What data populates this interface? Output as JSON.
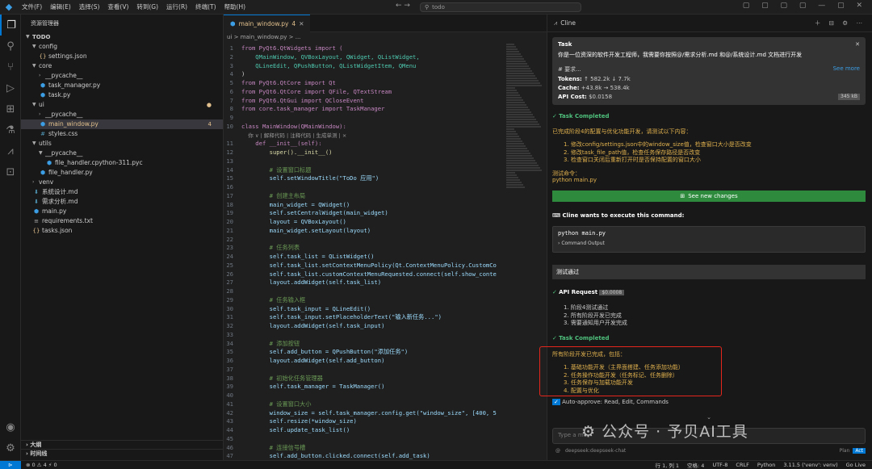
{
  "titlebar": {
    "menus": [
      "文件(F)",
      "编辑(E)",
      "选择(S)",
      "查看(V)",
      "转到(G)",
      "运行(R)",
      "终端(T)",
      "帮助(H)"
    ],
    "search": "todo"
  },
  "sidebar": {
    "title": "资源管理器",
    "root": "TODO",
    "items": [
      {
        "label": "config",
        "depth": 1,
        "type": "folder",
        "open": true
      },
      {
        "label": "settings.json",
        "depth": 2,
        "type": "json"
      },
      {
        "label": "core",
        "depth": 1,
        "type": "folder",
        "open": true
      },
      {
        "label": "__pycache__",
        "depth": 2,
        "type": "folder",
        "open": false
      },
      {
        "label": "task_manager.py",
        "depth": 2,
        "type": "py"
      },
      {
        "label": "task.py",
        "depth": 2,
        "type": "py"
      },
      {
        "label": "ui",
        "depth": 1,
        "type": "folder",
        "open": true,
        "mod": true
      },
      {
        "label": "__pycache__",
        "depth": 2,
        "type": "folder",
        "open": false
      },
      {
        "label": "main_window.py",
        "depth": 2,
        "type": "py",
        "sel": true,
        "badge": "4"
      },
      {
        "label": "styles.css",
        "depth": 2,
        "type": "css"
      },
      {
        "label": "utils",
        "depth": 1,
        "type": "folder",
        "open": true
      },
      {
        "label": "__pycache__",
        "depth": 2,
        "type": "folder",
        "open": true
      },
      {
        "label": "file_handler.cpython-311.pyc",
        "depth": 3,
        "type": "pyc"
      },
      {
        "label": "file_handler.py",
        "depth": 2,
        "type": "py"
      },
      {
        "label": "venv",
        "depth": 1,
        "type": "folder",
        "open": false
      },
      {
        "label": "系统设计.md",
        "depth": 1,
        "type": "md"
      },
      {
        "label": "需求分析.md",
        "depth": 1,
        "type": "md"
      },
      {
        "label": "main.py",
        "depth": 1,
        "type": "py"
      },
      {
        "label": "requirements.txt",
        "depth": 1,
        "type": "txt"
      },
      {
        "label": "tasks.json",
        "depth": 1,
        "type": "json"
      }
    ],
    "outline": "大纲",
    "timeline": "时间线"
  },
  "editor": {
    "tab": "main_window.py",
    "tab_badge": "4",
    "breadcrumb": "ui  >  main_window.py  > ...",
    "lines": [
      {
        "n": "1",
        "t": "from PyQt6.QtWidgets import ("
      },
      {
        "n": "2",
        "t": "    QMainWindow, QVBoxLayout, QWidget, QListWidget,"
      },
      {
        "n": "3",
        "t": "    QLineEdit, QPushButton, QListWidgetItem, QMenu"
      },
      {
        "n": "4",
        "t": ")"
      },
      {
        "n": "5",
        "t": "from PyQt6.QtCore import Qt"
      },
      {
        "n": "6",
        "t": "from PyQt6.QtCore import QFile, QTextStream"
      },
      {
        "n": "7",
        "t": "from PyQt6.QtGui import QCloseEvent"
      },
      {
        "n": "8",
        "t": "from core.task_manager import TaskManager"
      },
      {
        "n": "9",
        "t": ""
      },
      {
        "n": "10",
        "t": "class MainWindow(QMainWindow):"
      },
      {
        "n": "",
        "t": "    你 ∨ | 解释代码 | 注释代码 | 生成单测 | ×",
        "hint": true
      },
      {
        "n": "11",
        "t": "    def __init__(self):"
      },
      {
        "n": "12",
        "t": "        super().__init__()"
      },
      {
        "n": "13",
        "t": ""
      },
      {
        "n": "14",
        "t": "        # 设置窗口标题"
      },
      {
        "n": "15",
        "t": "        self.setWindowTitle(\"ToDo 应用\")"
      },
      {
        "n": "16",
        "t": ""
      },
      {
        "n": "17",
        "t": "        # 创建主布局"
      },
      {
        "n": "18",
        "t": "        main_widget = QWidget()"
      },
      {
        "n": "19",
        "t": "        self.setCentralWidget(main_widget)"
      },
      {
        "n": "20",
        "t": "        layout = QVBoxLayout()"
      },
      {
        "n": "21",
        "t": "        main_widget.setLayout(layout)"
      },
      {
        "n": "22",
        "t": ""
      },
      {
        "n": "23",
        "t": "        # 任务列表"
      },
      {
        "n": "24",
        "t": "        self.task_list = QListWidget()"
      },
      {
        "n": "25",
        "t": "        self.task_list.setContextMenuPolicy(Qt.ContextMenuPolicy.CustomCo"
      },
      {
        "n": "26",
        "t": "        self.task_list.customContextMenuRequested.connect(self.show_conte"
      },
      {
        "n": "27",
        "t": "        layout.addWidget(self.task_list)"
      },
      {
        "n": "28",
        "t": ""
      },
      {
        "n": "29",
        "t": "        # 任务输入框"
      },
      {
        "n": "30",
        "t": "        self.task_input = QLineEdit()"
      },
      {
        "n": "31",
        "t": "        self.task_input.setPlaceholderText(\"输入新任务...\")"
      },
      {
        "n": "32",
        "t": "        layout.addWidget(self.task_input)"
      },
      {
        "n": "33",
        "t": ""
      },
      {
        "n": "34",
        "t": "        # 添加按钮"
      },
      {
        "n": "35",
        "t": "        self.add_button = QPushButton(\"添加任务\")"
      },
      {
        "n": "36",
        "t": "        layout.addWidget(self.add_button)"
      },
      {
        "n": "37",
        "t": ""
      },
      {
        "n": "38",
        "t": "        # 初始化任务管理器"
      },
      {
        "n": "39",
        "t": "        self.task_manager = TaskManager()"
      },
      {
        "n": "40",
        "t": ""
      },
      {
        "n": "41",
        "t": "        # 设置窗口大小"
      },
      {
        "n": "42",
        "t": "        window_size = self.task_manager.config.get(\"window_size\", [400, 5"
      },
      {
        "n": "43",
        "t": "        self.resize(*window_size)"
      },
      {
        "n": "44",
        "t": "        self.update_task_list()"
      },
      {
        "n": "45",
        "t": ""
      },
      {
        "n": "46",
        "t": "        # 连接信号槽"
      },
      {
        "n": "47",
        "t": "        self.add_button.clicked.connect(self.add_task)"
      }
    ]
  },
  "cline": {
    "title": "Cline",
    "task": {
      "label": "Task",
      "text": "你是一位资深的软件开发工程师，我需要你按照@/需求分析.md 和@/系统设计.md 文档进行开发",
      "req": "# 要求...",
      "see_more": "See more",
      "tokens_label": "Tokens:",
      "tokens": "↑ 582.2k ↓ 7.7k",
      "cache_label": "Cache:",
      "cache": "+43.8k → 538.4k",
      "cost_label": "API Cost:",
      "cost": "$0.0158",
      "size": "345 kB"
    },
    "completed1": "Task Completed",
    "summary_title": "已完成阶段4的配置与优化功能开发，请测试以下内容：",
    "summary_items": [
      "1. 修改config/settings.json中的window_size值，检查窗口大小是否改变",
      "2. 修改task_file_path值，检查任务保存路径是否改变",
      "3. 检查窗口关闭后重新打开时是否保持配置的窗口大小"
    ],
    "test_cmd_label": "测试命令：",
    "test_cmd": "python main.py",
    "see_changes": "See new changes",
    "execute_label": "Cline wants to execute this command:",
    "command": "python main.py",
    "command_output": "Command Output",
    "test_pass": "测试通过",
    "api_request": "API Request",
    "api_cost": "$0.0008",
    "api_items": [
      "1. 阶段4测试通过",
      "2. 所有阶段开发已完成",
      "3. 需要通知用户开发完成"
    ],
    "completed2": "Task Completed",
    "final_title": "所有阶段开发已完成，包括：",
    "final_items": [
      "1. 基础功能开发（主界面搭建、任务添加功能）",
      "2. 任务操作功能开发（任务标记、任务删除）",
      "3. 任务保存与加载功能开发",
      "4. 配置与优化"
    ],
    "auto_approve": "Auto-approve:",
    "auto_approve_value": "Read, Edit, Commands",
    "input_placeholder": "Type a me",
    "model": "deepseek:deepseek-chat",
    "plan": "Plan",
    "act": "Act"
  },
  "watermark": "公众号 · 予贝AI工具",
  "status": {
    "left": "⊗ 0 ⚠ 4   ⚡ 0",
    "pos": "行 1, 列 1",
    "spaces": "空格: 4",
    "enc": "UTF-8",
    "eol": "CRLF",
    "lang": "Python",
    "ver": "3.11.5 ('venv': venv)",
    "golive": "Go Live"
  }
}
